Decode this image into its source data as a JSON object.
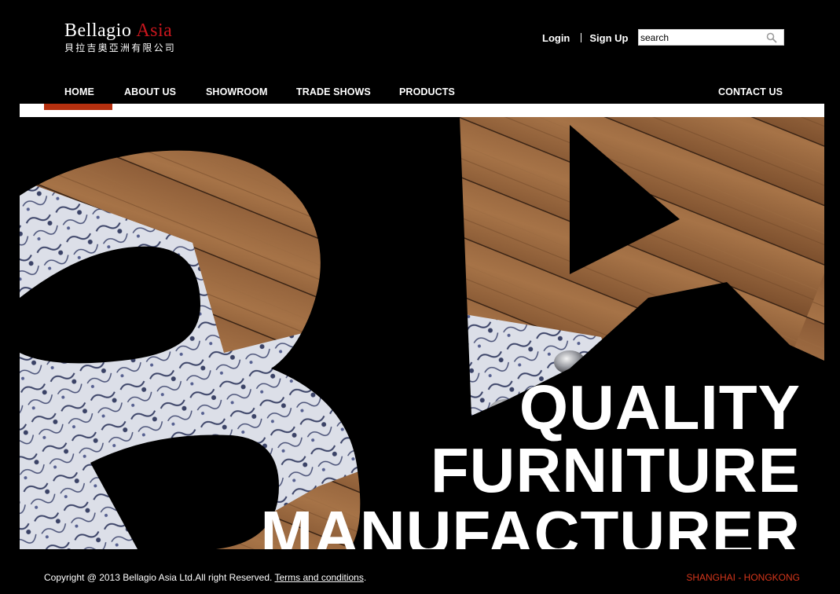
{
  "brand": {
    "name_part1": "Bellagio",
    "name_part2": "Asia",
    "name_chinese": "貝拉吉奧亞洲有限公司",
    "accent_color": "#c8161d"
  },
  "account": {
    "login_label": "Login",
    "signup_label": "Sign Up"
  },
  "search": {
    "placeholder": "search",
    "icon": "magnifier-icon"
  },
  "nav": {
    "items": [
      {
        "label": "HOME",
        "active": true
      },
      {
        "label": "ABOUT US"
      },
      {
        "label": "SHOWROOM"
      },
      {
        "label": "TRADE SHOWS"
      },
      {
        "label": "PRODUCTS"
      },
      {
        "label": "CONTACT US"
      }
    ],
    "active_color": "#b5300f"
  },
  "hero": {
    "headline_lines": [
      "QUALITY",
      "FURNITURE",
      "MANUFACTURER"
    ],
    "image_description_icon": "hero-photo-upholstered-chair-on-wood-floor"
  },
  "footer": {
    "copyright": "Copyright @ 2013 Bellagio Asia Ltd.All right Reserved.",
    "terms_label": "Terms and conditions",
    "terms_suffix": ".",
    "locations": "SHANGHAI - HONGKONG",
    "locations_color": "#d6361b"
  }
}
